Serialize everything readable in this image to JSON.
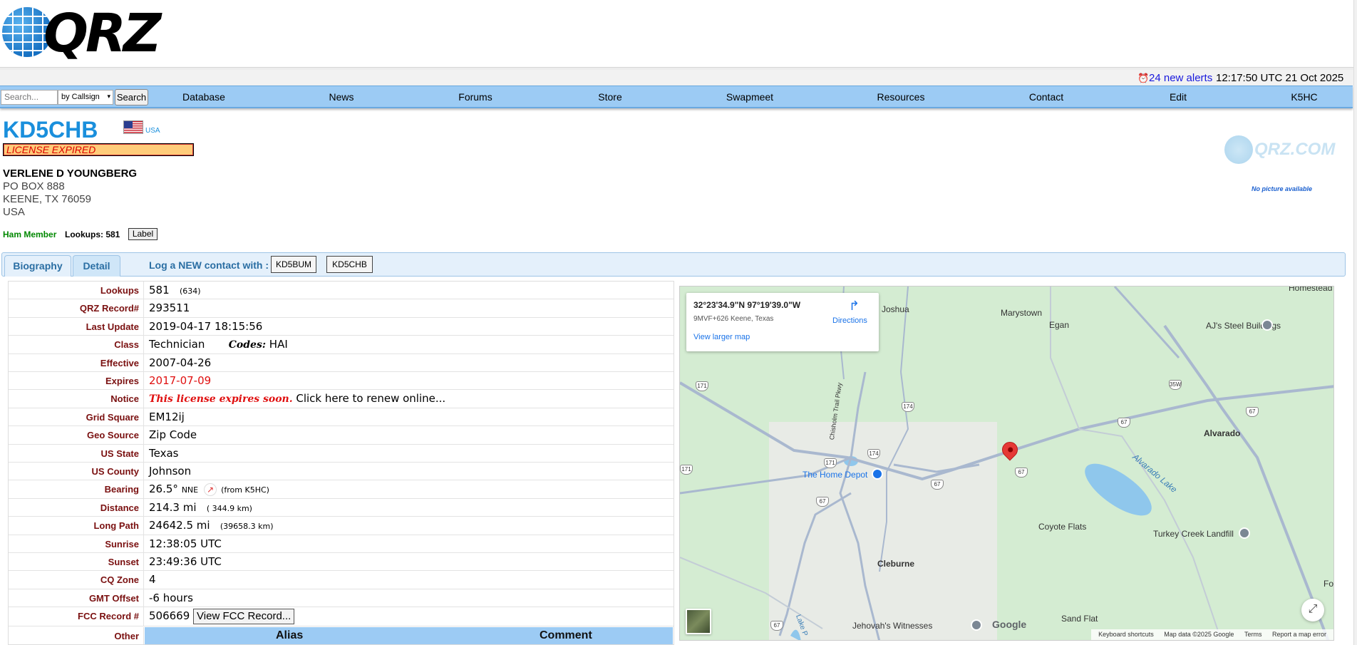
{
  "header": {
    "logo_text": "QRZ",
    "alerts_label": "24 new alerts",
    "time": "12:17:50 UTC 21 Oct 2025"
  },
  "nav": {
    "search_placeholder": "Search...",
    "search_by": "by Callsign",
    "search_button": "Search",
    "items": [
      "Database",
      "News",
      "Forums",
      "Store",
      "Swapmeet",
      "Resources",
      "Contact",
      "Edit",
      "K5HC"
    ]
  },
  "profile": {
    "callsign": "KD5CHB",
    "country": "USA",
    "license_status": "LICENSE EXPIRED",
    "name": "VERLENE D YOUNGBERG",
    "address_lines": [
      "PO BOX 888",
      "KEENE, TX 76059",
      "USA"
    ],
    "member_type": "Ham Member",
    "lookups_label": "Lookups: 581",
    "label_button": "Label",
    "watermark": "QRZ.COM",
    "no_picture": "No picture available"
  },
  "tabs": {
    "biography": "Biography",
    "detail": "Detail",
    "log_text": "Log a NEW contact with :",
    "log_buttons": [
      "KD5BUM",
      "KD5CHB"
    ]
  },
  "details": {
    "lookups": {
      "label": "Lookups",
      "value": "581",
      "extra": "(634)"
    },
    "record": {
      "label": "QRZ Record#",
      "value": "293511"
    },
    "last_update": {
      "label": "Last Update",
      "value": "2019-04-17 18:15:56"
    },
    "class": {
      "label": "Class",
      "value": "Technician",
      "codes_label": "Codes:",
      "codes": "HAI"
    },
    "effective": {
      "label": "Effective",
      "value": "2007-04-26"
    },
    "expires": {
      "label": "Expires",
      "value": "2017-07-09"
    },
    "notice": {
      "label": "Notice",
      "em": "This license expires soon.",
      "text": "Click here to renew online..."
    },
    "grid": {
      "label": "Grid Square",
      "value": "EM12ij"
    },
    "geo": {
      "label": "Geo Source",
      "value": "Zip Code"
    },
    "state": {
      "label": "US State",
      "value": "Texas"
    },
    "county": {
      "label": "US County",
      "value": "Johnson"
    },
    "bearing": {
      "label": "Bearing",
      "value": "26.5°",
      "dir": "NNE",
      "from": "(from K5HC)"
    },
    "distance": {
      "label": "Distance",
      "value": "214.3 mi",
      "km": "( 344.9 km)"
    },
    "long_path": {
      "label": "Long Path",
      "value": "24642.5 mi",
      "km": "(39658.3 km)"
    },
    "sunrise": {
      "label": "Sunrise",
      "value": "12:38:05 UTC"
    },
    "sunset": {
      "label": "Sunset",
      "value": "23:49:36 UTC"
    },
    "cq": {
      "label": "CQ Zone",
      "value": "4"
    },
    "gmt": {
      "label": "GMT Offset",
      "value": "-6 hours"
    },
    "fcc": {
      "label": "FCC Record #",
      "value": "506669",
      "button": "View FCC Record..."
    },
    "other": {
      "label": "Other",
      "col1": "Alias",
      "col2": "Comment"
    }
  },
  "map": {
    "coords": "32°23'34.9\"N 97°19'39.0\"W",
    "plus_code": "9MVF+626 Keene, Texas",
    "larger": "View larger map",
    "directions": "Directions",
    "places": {
      "joshua": "Joshua",
      "marystown": "Marystown",
      "egan": "Egan",
      "ajs": "AJ's Steel Buildings",
      "homestead": "Homestead",
      "alvarado": "Alvarado",
      "home_depot": "The Home Depot",
      "alvarado_lake": "Alvarado Lake",
      "coyote": "Coyote Flats",
      "turkey": "Turkey Creek Landfill",
      "cleburne": "Cleburne",
      "jehovah": "Jehovah's Witnesses",
      "sand_flat": "Sand Flat",
      "chisholm": "Chisholm Trail Pkwy",
      "lake": "Lake P",
      "fo": "Fo"
    },
    "routes": [
      "171",
      "174",
      "171",
      "174",
      "67",
      "67",
      "67",
      "67",
      "35W",
      "67",
      "171",
      "67"
    ],
    "google": "Google",
    "attribution": [
      "Keyboard shortcuts",
      "Map data ©2025 Google",
      "Terms",
      "Report a map error"
    ]
  }
}
